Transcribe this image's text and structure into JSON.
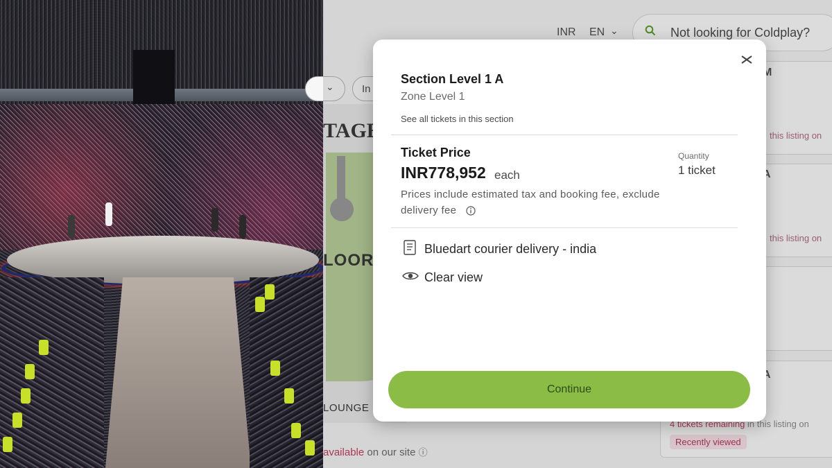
{
  "header": {
    "currency": "INR",
    "language": "EN",
    "search_placeholder": "Not looking for Coldplay?"
  },
  "filters": {
    "chip_2_label": "In"
  },
  "venue_map": {
    "stage_label": "TAGE",
    "floor_label": "LOOR",
    "lounge_label": "LOUNGE"
  },
  "listing": {
    "card_1_letter": "M",
    "card_1_note": "this listing on",
    "card_2_letter": "A",
    "card_2_note": "this listing on",
    "card_4_letter": "A",
    "card_4_remaining_count": "4 tickets remaining",
    "card_4_remaining_rest": " in this listing on",
    "recently_viewed": "Recently viewed"
  },
  "footer": {
    "available_accent": "available",
    "available_rest": " on our site"
  },
  "modal": {
    "section_title": "Section Level 1 A",
    "zone": "Zone Level 1",
    "see_all": "See all tickets in this section",
    "price_heading": "Ticket Price",
    "price": "INR778,952",
    "price_suffix": "each",
    "quantity_label": "Quantity",
    "quantity_value": "1 ticket",
    "price_note_line1": "Prices include estimated tax and booking fee, exclude",
    "price_note_line2": "delivery fee",
    "delivery": "Bluedart courier delivery - india",
    "view": "Clear view",
    "continue_label": "Continue"
  },
  "colors": {
    "accent_green": "#8bbd46",
    "accent_pink": "#c04060"
  },
  "icons": [
    "close-icon",
    "search-icon",
    "info-icon",
    "ticket-document-icon",
    "eye-icon",
    "chevron-down-icon"
  ]
}
